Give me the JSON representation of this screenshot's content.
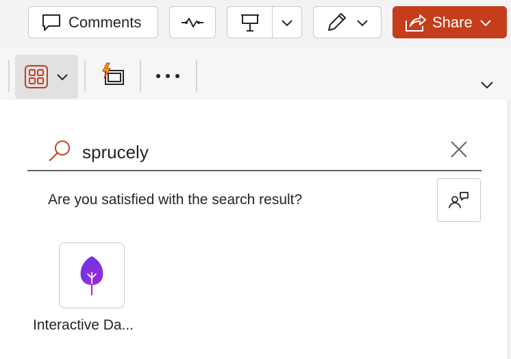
{
  "toolbar": {
    "comments_label": "Comments",
    "share_label": "Share"
  },
  "search": {
    "query": "sprucely",
    "placeholder": ""
  },
  "feedback": {
    "question": "Are you satisfied with the search result?"
  },
  "results": [
    {
      "label": "Interactive Da...",
      "icon": "sprout-leaf-icon"
    }
  ],
  "colors": {
    "accent": "#c43e1c",
    "result_icon": "#7a2fe0",
    "search_icon": "#c43e1c"
  }
}
